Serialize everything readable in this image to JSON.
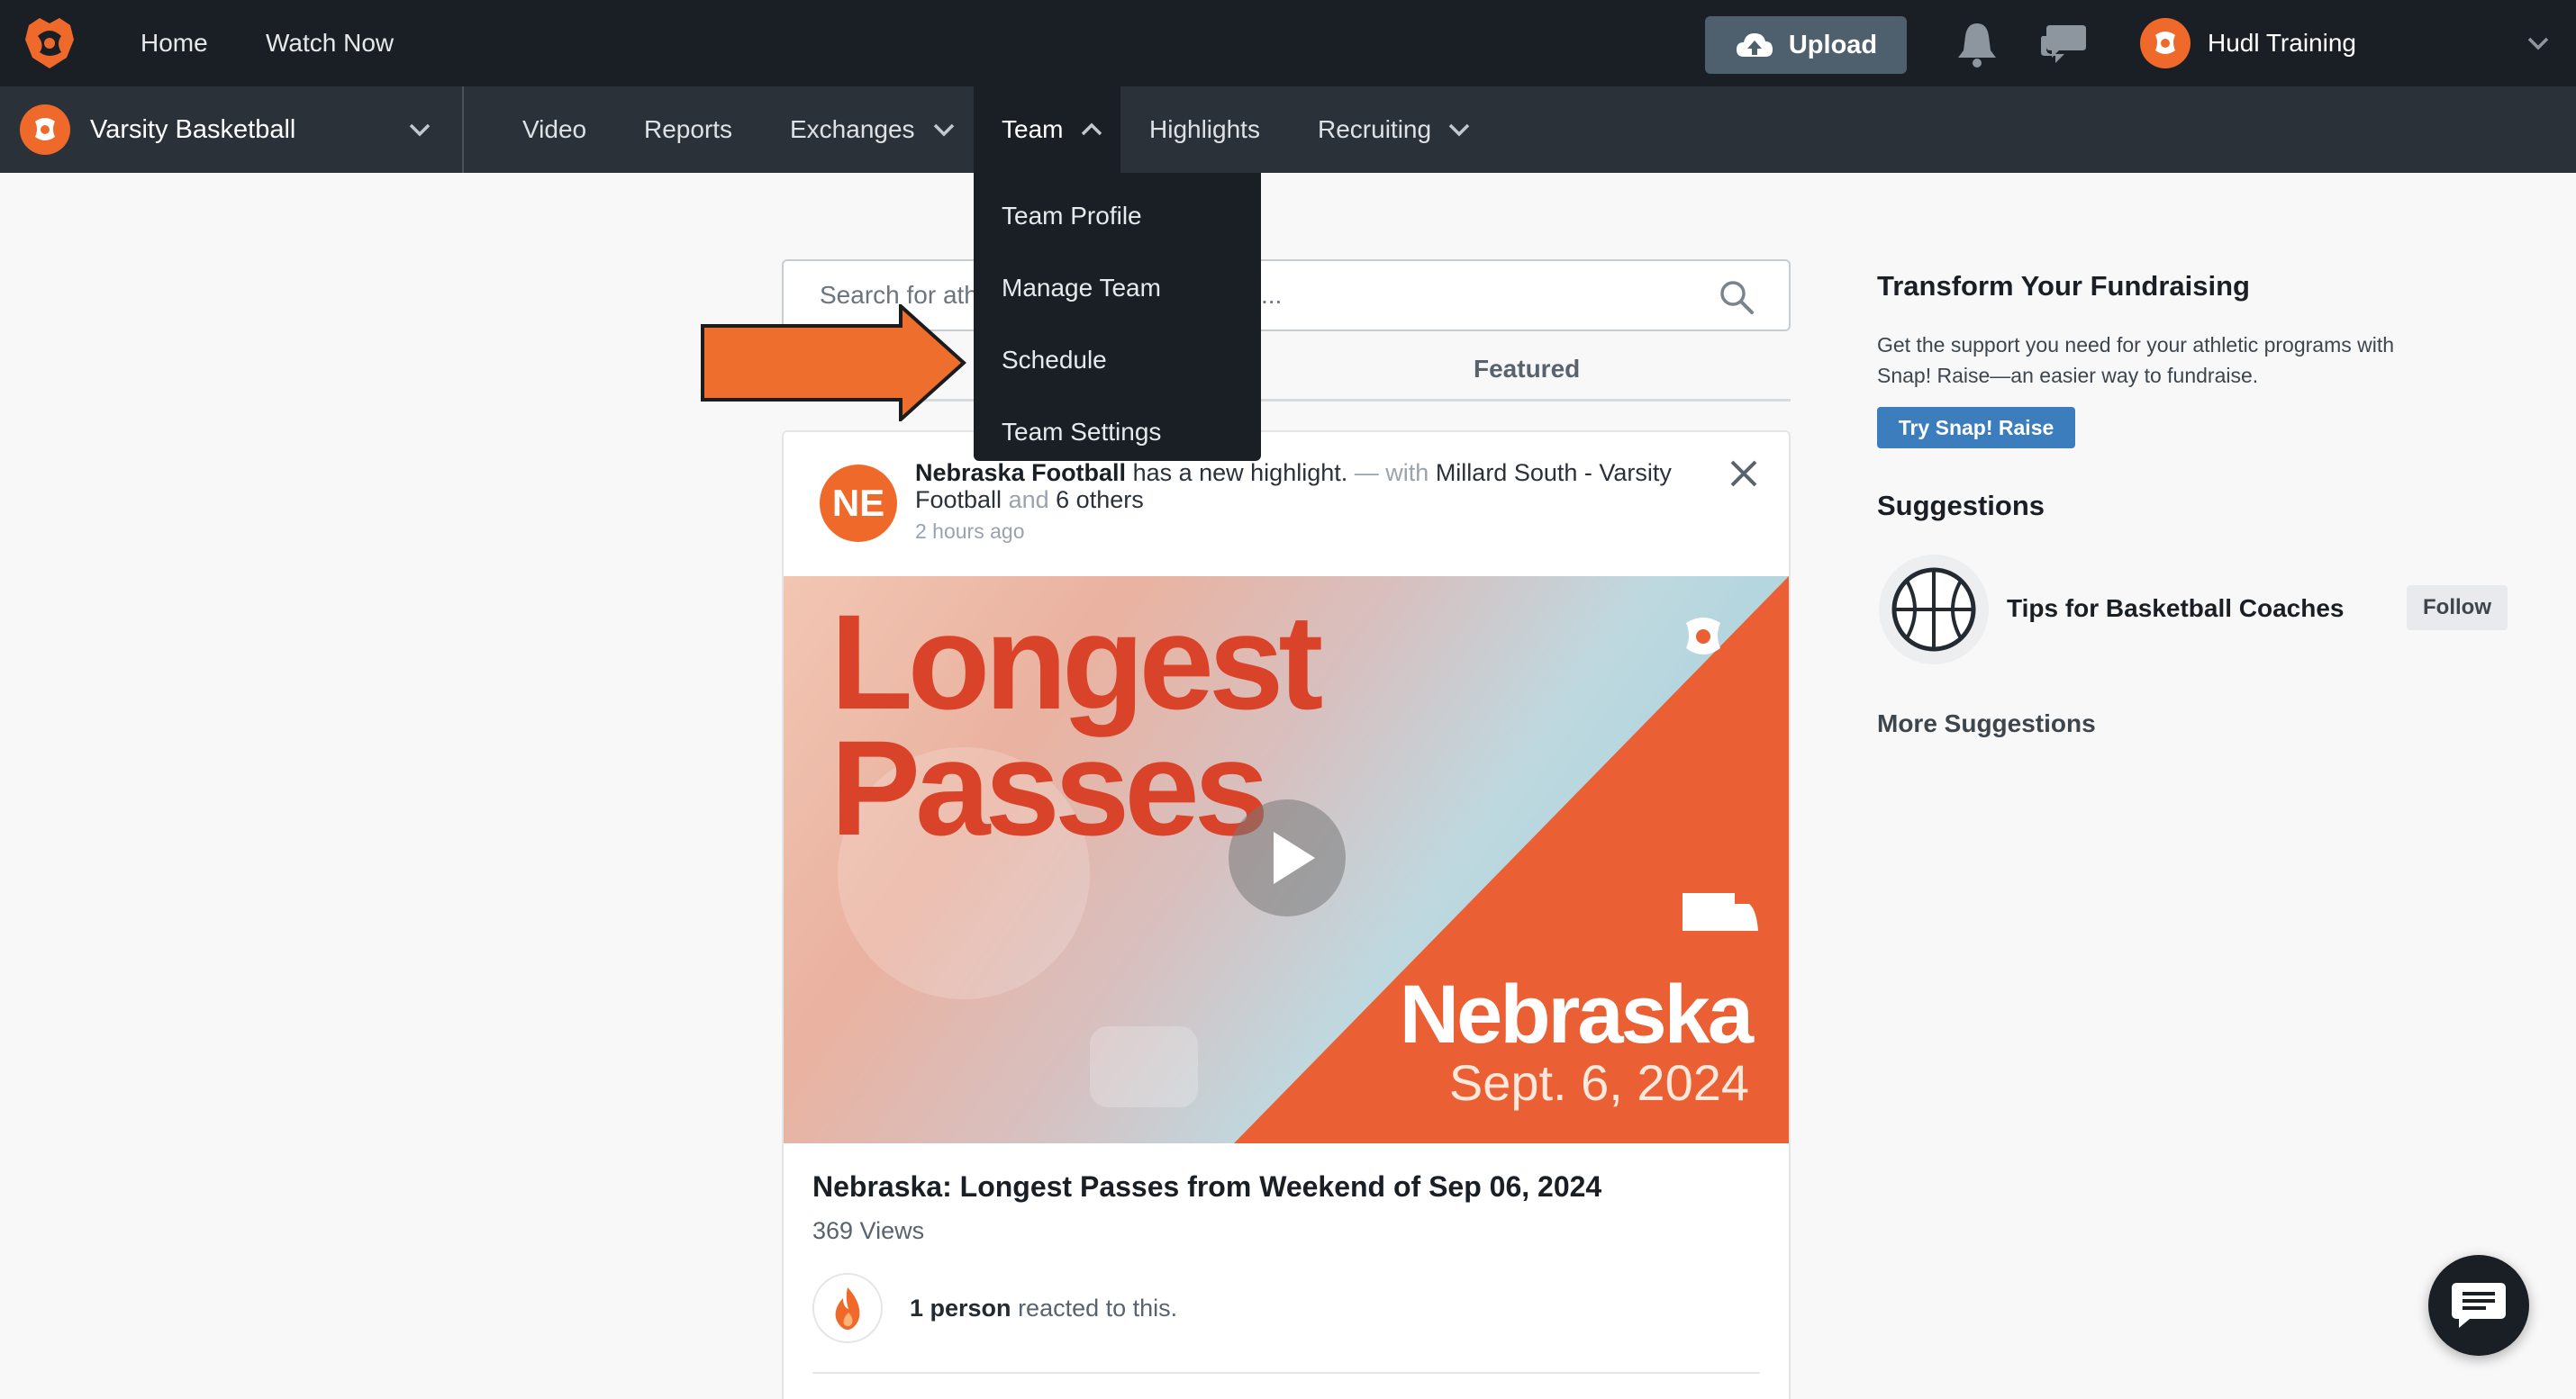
{
  "topbar": {
    "nav": [
      {
        "label": "Home"
      },
      {
        "label": "Watch Now"
      }
    ],
    "upload_label": "Upload",
    "user_name": "Hudl Training"
  },
  "subbar": {
    "team_name": "Varsity Basketball",
    "nav": [
      {
        "label": "Video"
      },
      {
        "label": "Reports"
      },
      {
        "label": "Exchanges"
      },
      {
        "label": "Team"
      },
      {
        "label": "Highlights"
      },
      {
        "label": "Recruiting"
      }
    ],
    "active_item": "Team"
  },
  "team_dropdown": {
    "items": [
      {
        "label": "Team Profile"
      },
      {
        "label": "Manage Team"
      },
      {
        "label": "Schedule"
      },
      {
        "label": "Team Settings"
      }
    ]
  },
  "search": {
    "placeholder_visible_start": "Search for ath",
    "placeholder_visible_end": "..."
  },
  "feed_tabs": {
    "featured_label": "Featured"
  },
  "post": {
    "avatar_initials": "NE",
    "author": "Nebraska Football",
    "action": "has a new highlight.",
    "with_text": "— with",
    "with_team": "Millard South - Varsity Football",
    "and_text": "and",
    "others": "6 others",
    "time": "2 hours ago",
    "media": {
      "title_line1": "Longest",
      "title_line2": "Passes",
      "team": "Nebraska",
      "date": "Sept. 6, 2024"
    },
    "title": "Nebraska: Longest Passes from Weekend of Sep 06, 2024",
    "views": "369 Views",
    "reaction_count": "1 person",
    "reaction_text": "reacted to this."
  },
  "sidebar": {
    "promo_heading": "Transform Your Fundraising",
    "promo_text": "Get the support you need for your athletic programs with Snap! Raise—an easier way to fundraise.",
    "promo_button": "Try Snap! Raise",
    "suggestions_heading": "Suggestions",
    "suggestions": [
      {
        "name": "Tips for Basketball Coaches",
        "follow_label": "Follow"
      }
    ],
    "more_label": "More Suggestions"
  },
  "colors": {
    "brand_orange": "#ef6a2a",
    "topbar": "#191f24",
    "subbar": "#2b3138",
    "link_blue": "#3b7dbd"
  }
}
